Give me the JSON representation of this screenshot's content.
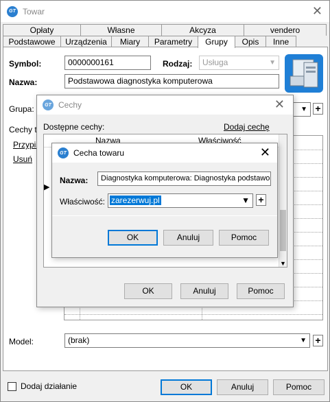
{
  "window": {
    "title": "Towar"
  },
  "tabs_top": [
    "Opłaty",
    "Własne",
    "Akcyza",
    "vendero"
  ],
  "tabs_bottom": [
    "Podstawowe",
    "Urządzenia",
    "Miary",
    "Parametry",
    "Grupy",
    "Opis",
    "Inne"
  ],
  "active_tab": "Grupy",
  "form": {
    "symbol_label": "Symbol:",
    "symbol_value": "0000000161",
    "rodzaj_label": "Rodzaj:",
    "rodzaj_value": "Usługa",
    "nazwa_label": "Nazwa:",
    "nazwa_value": "Podstawowa diagnostyka komputerowa",
    "grupa_label": "Grupa:",
    "cechy_label": "Cechy to",
    "przypis_link": "Przypis",
    "usun_link": "Usuń",
    "model_label": "Model:",
    "model_value": "(brak)"
  },
  "footer": {
    "dodaj_dzialanie": "Dodaj działanie",
    "ok": "OK",
    "anuluj": "Anuluj",
    "pomoc": "Pomoc"
  },
  "cechy_dialog": {
    "title": "Cechy",
    "dostepne_label": "Dostępne cechy:",
    "dodaj_link": "Dodaj cechę",
    "col_nazwa": "Nazwa",
    "col_wlasciwosc": "Właściwość",
    "ok": "OK",
    "anuluj": "Anuluj",
    "pomoc": "Pomoc"
  },
  "cecha_dialog": {
    "title": "Cecha towaru",
    "nazwa_label": "Nazwa:",
    "nazwa_value": "Diagnostyka komputerowa: Diagnostyka podstawo",
    "wlasciwosc_label": "Właściwość:",
    "wlasciwosc_value": "zarezerwuj.pl",
    "ok": "OK",
    "anuluj": "Anuluj",
    "pomoc": "Pomoc"
  },
  "icons": {
    "app": "gt-logo-icon",
    "close": "close-icon",
    "dropdown": "chevron-down-icon",
    "product": "computer-product-icon"
  },
  "colors": {
    "accent": "#0078d7",
    "selection": "#0078d7"
  }
}
